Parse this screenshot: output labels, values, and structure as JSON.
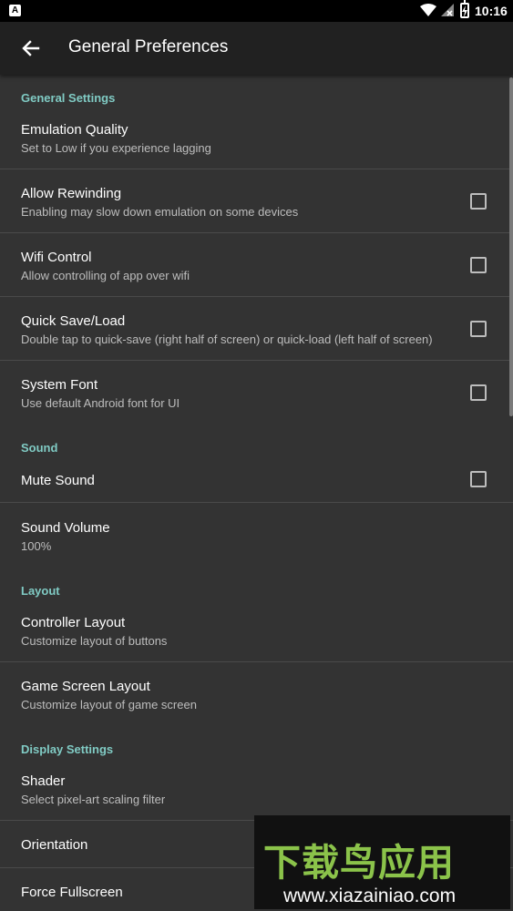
{
  "status_bar": {
    "time": "10:16",
    "notification_glyph": "A"
  },
  "app_bar": {
    "title": "General Preferences",
    "back_icon": "arrow-back-icon"
  },
  "sections": {
    "general": {
      "header": "General Settings",
      "emulation_quality": {
        "title": "Emulation Quality",
        "summary": "Set to Low if you experience lagging"
      },
      "allow_rewinding": {
        "title": "Allow Rewinding",
        "summary": "Enabling may slow down emulation on some devices",
        "checked": false
      },
      "wifi_control": {
        "title": "Wifi Control",
        "summary": "Allow controlling of app over wifi",
        "checked": false
      },
      "quick_save_load": {
        "title": "Quick Save/Load",
        "summary": "Double tap to quick-save (right half of screen) or quick-load (left half of screen)",
        "checked": false
      },
      "system_font": {
        "title": "System Font",
        "summary": "Use default Android font for UI",
        "checked": false
      }
    },
    "sound": {
      "header": "Sound",
      "mute_sound": {
        "title": "Mute Sound",
        "checked": false
      },
      "sound_volume": {
        "title": "Sound Volume",
        "summary": "100%"
      }
    },
    "layout": {
      "header": "Layout",
      "controller_layout": {
        "title": "Controller Layout",
        "summary": "Customize layout of buttons"
      },
      "game_screen_layout": {
        "title": "Game Screen Layout",
        "summary": "Customize layout of game screen"
      }
    },
    "display": {
      "header": "Display Settings",
      "shader": {
        "title": "Shader",
        "summary": "Select pixel-art scaling filter"
      },
      "orientation": {
        "title": "Orientation"
      },
      "force_fullscreen": {
        "title": "Force Fullscreen"
      }
    }
  },
  "watermark": {
    "text_cn": "下载鸟应用",
    "url": "www.xiazainiao.com"
  },
  "colors": {
    "accent": "#80cbc4",
    "background": "#333333",
    "app_bar": "#212121",
    "watermark_green": "#8bc34a"
  }
}
